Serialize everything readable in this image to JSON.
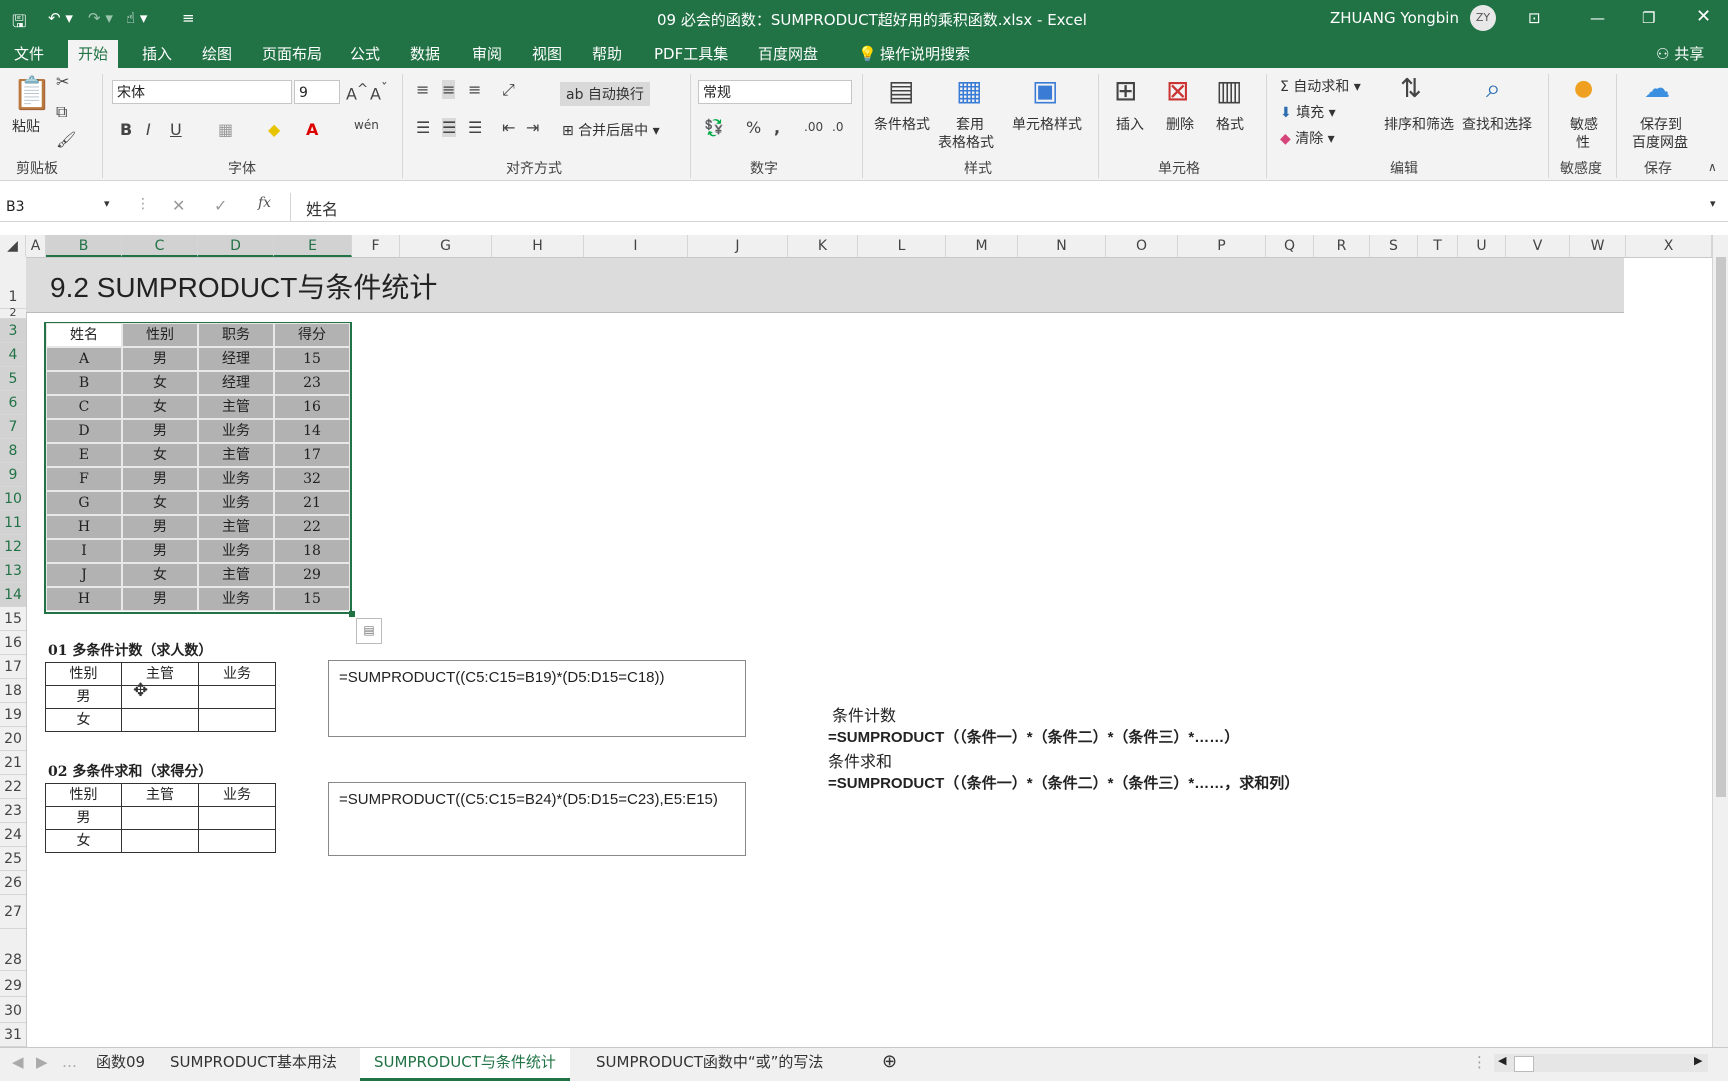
{
  "window": {
    "title": "09 必会的函数：SUMPRODUCT超好用的乘积函数.xlsx  -  Excel",
    "user": "ZHUANG Yongbin",
    "user_initials": "ZY"
  },
  "tabs": [
    "文件",
    "开始",
    "插入",
    "绘图",
    "页面布局",
    "公式",
    "数据",
    "审阅",
    "视图",
    "帮助",
    "PDF工具集",
    "百度网盘",
    "操作说明搜索"
  ],
  "share": "共享",
  "ribbon": {
    "clipboard": {
      "paste": "粘贴",
      "group": "剪贴板"
    },
    "font": {
      "name": "宋体",
      "size": "9",
      "group": "字体"
    },
    "align": {
      "wrap": "自动换行",
      "merge": "合并后居中",
      "group": "对齐方式"
    },
    "number": {
      "format": "常规",
      "group": "数字"
    },
    "styles": {
      "cond": "条件格式",
      "table1": "套用",
      "table2": "表格格式",
      "cell": "单元格样式",
      "group": "样式"
    },
    "cells": {
      "insert": "插入",
      "delete": "删除",
      "format": "格式",
      "group": "单元格"
    },
    "edit": {
      "autosum": "自动求和",
      "fill": "填充",
      "clear": "清除",
      "sort": "排序和筛选",
      "find": "查找和选择",
      "group": "编辑"
    },
    "sens": {
      "l1": "敏感",
      "l2": "性",
      "group": "敏感度"
    },
    "save": {
      "l1": "保存到",
      "l2": "百度网盘",
      "group": "保存"
    }
  },
  "formula_bar": {
    "name_box": "B3",
    "fx": "fx",
    "value": "姓名"
  },
  "columns": [
    "A",
    "B",
    "C",
    "D",
    "E",
    "F",
    "G",
    "H",
    "I",
    "J",
    "K",
    "L",
    "M",
    "N",
    "O",
    "P",
    "Q",
    "R",
    "S",
    "T",
    "U",
    "V",
    "W",
    "X"
  ],
  "rows": [
    "1",
    "2",
    "3",
    "4",
    "5",
    "6",
    "7",
    "8",
    "9",
    "10",
    "11",
    "12",
    "13",
    "14",
    "15",
    "16",
    "17",
    "18",
    "19",
    "20",
    "21",
    "22",
    "23",
    "24",
    "25",
    "26",
    "27",
    "28",
    "29",
    "30",
    "31"
  ],
  "sheet_title": "9.2 SUMPRODUCT与条件统计",
  "table": {
    "headers": [
      "姓名",
      "性别",
      "职务",
      "得分"
    ],
    "rows": [
      [
        "A",
        "男",
        "经理",
        "15"
      ],
      [
        "B",
        "女",
        "经理",
        "23"
      ],
      [
        "C",
        "女",
        "主管",
        "16"
      ],
      [
        "D",
        "男",
        "业务",
        "14"
      ],
      [
        "E",
        "女",
        "主管",
        "17"
      ],
      [
        "F",
        "男",
        "业务",
        "32"
      ],
      [
        "G",
        "女",
        "业务",
        "21"
      ],
      [
        "H",
        "男",
        "主管",
        "22"
      ],
      [
        "I",
        "男",
        "业务",
        "18"
      ],
      [
        "J",
        "女",
        "主管",
        "29"
      ],
      [
        "H",
        "男",
        "业务",
        "15"
      ]
    ]
  },
  "section1": {
    "title": "01 多条件计数（求人数）",
    "headers": [
      "性别",
      "主管",
      "业务"
    ],
    "rows": [
      "男",
      "女"
    ],
    "formula": "=SUMPRODUCT((C5:C15=B19)*(D5:D15=C18))"
  },
  "section2": {
    "title": "02 多条件求和（求得分）",
    "headers": [
      "性别",
      "主管",
      "业务"
    ],
    "rows": [
      "男",
      "女"
    ],
    "formula": "=SUMPRODUCT((C5:C15=B24)*(D5:D15=C23),E5:E15)"
  },
  "notes": {
    "count_label": "条件计数",
    "count_formula": "=SUMPRODUCT（（条件一）*（条件二）*（条件三）*……）",
    "sum_label": "条件求和",
    "sum_formula": "=SUMPRODUCT（（条件一）*（条件二）*（条件三）*……，求和列）"
  },
  "sheet_tabs": [
    "函数09",
    "SUMPRODUCT基本用法",
    "SUMPRODUCT与条件统计",
    "SUMPRODUCT函数中“或”的写法"
  ]
}
